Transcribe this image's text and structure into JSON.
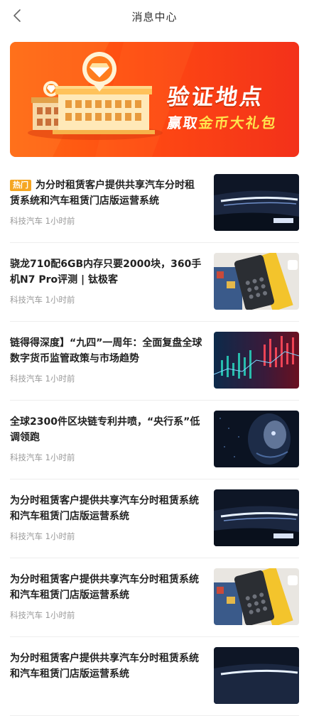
{
  "header": {
    "title": "消息中心"
  },
  "banner": {
    "line1": "验证地点",
    "line2_prefix": "赢取",
    "line2_highlight": "金币大礼包"
  },
  "articles": [
    {
      "badge": "热门",
      "title": "为分时租赁客户提供共享汽车分时租赁系统和汽车租赁门店版运营系统",
      "meta": "科技汽车 1小时前",
      "thumb": "car-headlight"
    },
    {
      "title": "骁龙710配6GB内存只要2000块，360手机N7 Pro评测 | 钛极客",
      "meta": "科技汽车 1小时前",
      "thumb": "phone-on-table"
    },
    {
      "title": "链得得深度】“九四”一周年：全面复盘全球数字货币监管政策与市场趋势",
      "meta": "科技汽车 1小时前",
      "thumb": "market-chart"
    },
    {
      "title": "全球2300件区块链专利井喷，“央行系”低调领跑",
      "meta": "科技汽车 1小时前",
      "thumb": "digital-face"
    },
    {
      "title": "为分时租赁客户提供共享汽车分时租赁系统和汽车租赁门店版运营系统",
      "meta": "科技汽车 1小时前",
      "thumb": "car-headlight"
    },
    {
      "title": "为分时租赁客户提供共享汽车分时租赁系统和汽车租赁门店版运营系统",
      "meta": "科技汽车 1小时前",
      "thumb": "phone-on-table"
    },
    {
      "title": "为分时租赁客户提供共享汽车分时租赁系统和汽车租赁门店版运营系统",
      "meta": "",
      "thumb": "car-headlight"
    }
  ]
}
